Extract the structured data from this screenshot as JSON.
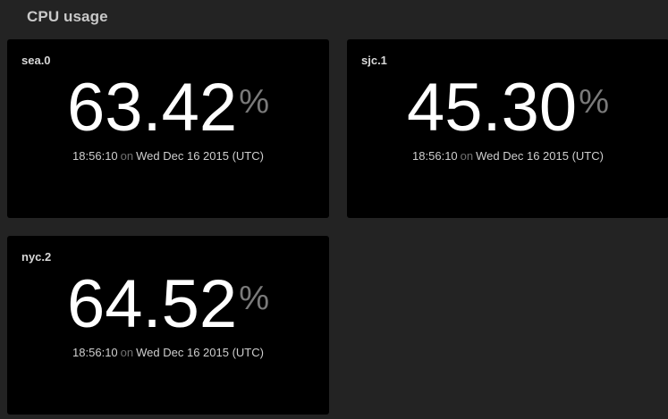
{
  "dashboard": {
    "title": "CPU usage"
  },
  "panels": [
    {
      "label": "sea.0",
      "value": "63.42",
      "unit": "%",
      "time": "18:56:10",
      "on": "on",
      "date": "Wed Dec 16 2015 (UTC)"
    },
    {
      "label": "sjc.1",
      "value": "45.30",
      "unit": "%",
      "time": "18:56:10",
      "on": "on",
      "date": "Wed Dec 16 2015 (UTC)"
    },
    {
      "label": "nyc.2",
      "value": "64.52",
      "unit": "%",
      "time": "18:56:10",
      "on": "on",
      "date": "Wed Dec 16 2015 (UTC)"
    }
  ],
  "colors": {
    "background": "#232323",
    "panel": "#000000",
    "value": "#ffffff",
    "unit": "#7a7a7a"
  }
}
